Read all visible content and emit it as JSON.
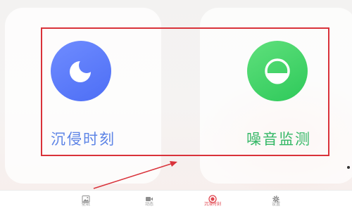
{
  "cards": [
    {
      "label": "沉侵时刻",
      "icon": "moon-icon",
      "color": "#5a7cf6"
    },
    {
      "label": "噪音监测",
      "icon": "half-circle-icon",
      "color": "#3ccd66"
    }
  ],
  "tabbar": {
    "items": [
      {
        "label": "壁纸",
        "icon": "image-icon",
        "active": false
      },
      {
        "label": "动态",
        "icon": "video-camera-icon",
        "active": false
      },
      {
        "label": "沉浸时刻",
        "icon": "record-icon",
        "active": true
      },
      {
        "label": "设置",
        "icon": "gear-icon",
        "active": false
      }
    ]
  },
  "annotation": {
    "highlight_color": "#d9323a"
  }
}
